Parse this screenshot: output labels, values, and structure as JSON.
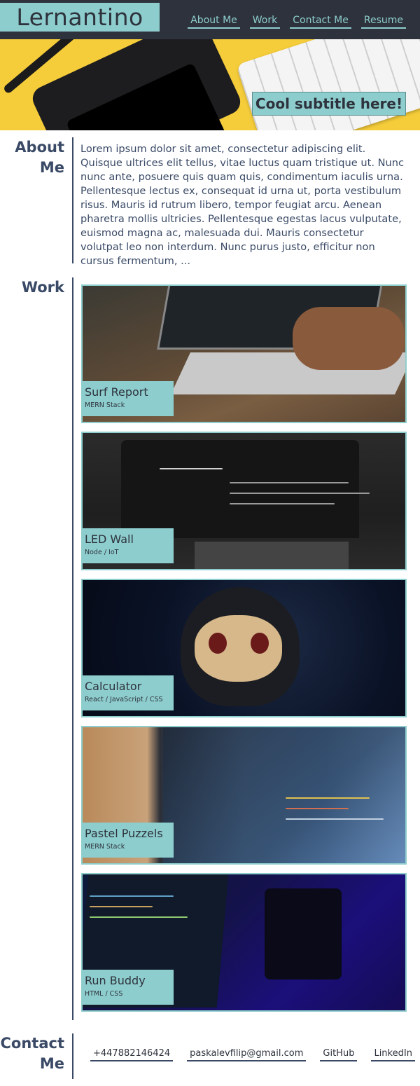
{
  "header": {
    "logo": "Lernantino",
    "nav": [
      "About Me",
      "Work",
      "Contact Me",
      "Resume"
    ]
  },
  "hero": {
    "subtitle": "Cool subtitle here!"
  },
  "about": {
    "title_line1": "About",
    "title_line2": "Me",
    "text": "Lorem ipsum dolor sit amet, consectetur adipiscing elit. Quisque ultrices elit tellus, vitae luctus quam tristique ut. Nunc nunc ante, posuere quis quam quis, condimentum iaculis urna. Pellentesque lectus ex, consequat id urna ut, porta vestibulum risus. Mauris id rutrum libero, tempor feugiat arcu. Aenean pharetra mollis ultricies. Pellentesque egestas lacus vulputate, euismod magna ac, malesuada dui. Mauris consectetur volutpat leo non interdum. Nunc purus justo, efficitur non cursus fermentum, ..."
  },
  "work": {
    "title": "Work",
    "projects": [
      {
        "title": "Surf Report",
        "stack": "MERN Stack"
      },
      {
        "title": "LED Wall",
        "stack": "Node / IoT"
      },
      {
        "title": "Calculator",
        "stack": "React / JavaScript / CSS"
      },
      {
        "title": "Pastel Puzzels",
        "stack": "MERN Stack"
      },
      {
        "title": "Run Buddy",
        "stack": "HTML / CSS"
      }
    ]
  },
  "contact": {
    "title_line1": "Contact",
    "title_line2": "Me",
    "links": [
      "+447882146424",
      "paskalevfilip@gmail.com",
      "GitHub",
      "LinkedIn"
    ]
  },
  "colors": {
    "dark": "#2d323c",
    "accent": "#8ecdcd",
    "text": "#3a4a66"
  }
}
